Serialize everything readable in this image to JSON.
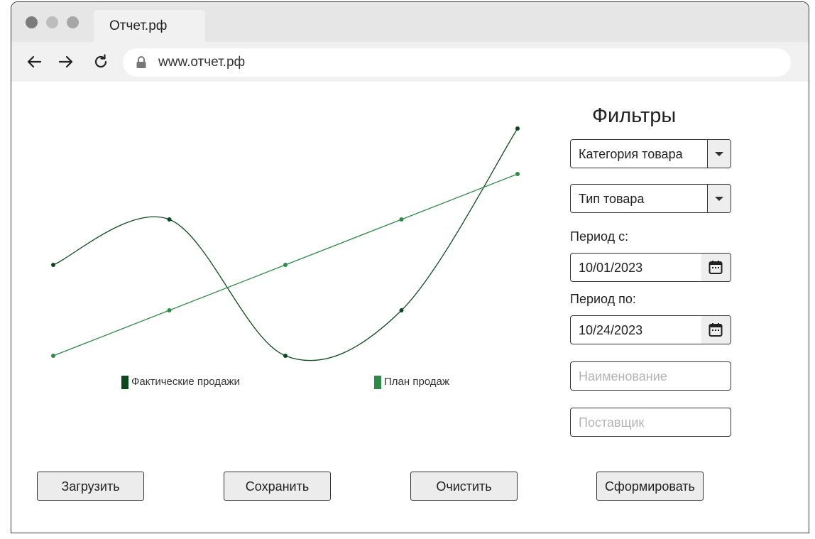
{
  "browser": {
    "tab_title": "Отчет.рф",
    "url": "www.отчет.рф"
  },
  "chart_data": {
    "type": "line",
    "x": [
      1,
      2,
      3,
      4,
      5
    ],
    "series": [
      {
        "name": "Фактические продажи",
        "values": [
          3,
          4,
          1,
          2,
          6
        ],
        "color": "#0b4a1e",
        "smooth": true
      },
      {
        "name": "План продаж",
        "values": [
          1,
          2,
          3,
          4,
          5
        ],
        "color": "#2e8b47",
        "smooth": false
      }
    ],
    "legend_position": "bottom"
  },
  "filters": {
    "title": "Фильтры",
    "category_select": "Категория товара",
    "type_select": "Тип товара",
    "period_from_label": "Период с:",
    "period_from_value": "10/01/2023",
    "period_to_label": "Период по:",
    "period_to_value": "10/24/2023",
    "name_placeholder": "Наименование",
    "supplier_placeholder": "Поставщик"
  },
  "buttons": {
    "load": "Загрузить",
    "save": "Сохранить",
    "clear": "Очистить",
    "generate": "Сформировать"
  }
}
